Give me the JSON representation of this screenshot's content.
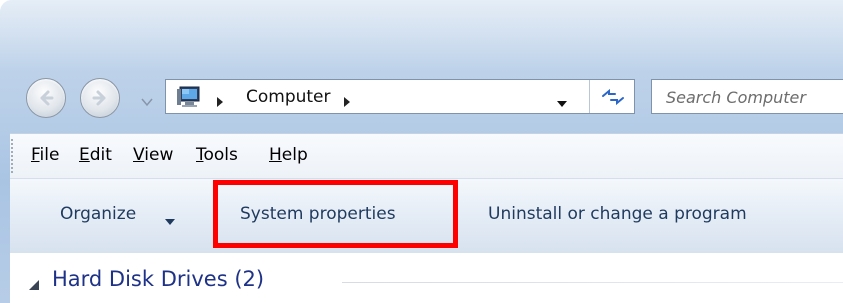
{
  "window": {
    "accent": "#1e3287",
    "frame_color": "#b9cfe8",
    "highlight_color": "#ff0000"
  },
  "navigation": {
    "back_icon": "back-arrow-icon",
    "forward_icon": "forward-arrow-icon",
    "history_icon": "chevron-down-icon"
  },
  "address_bar": {
    "location_icon": "computer-icon",
    "path": "Computer",
    "refresh_icon": "refresh-icon"
  },
  "search": {
    "placeholder": "Search Computer"
  },
  "menu": {
    "items": [
      {
        "label": "File",
        "accel": "F",
        "rest": "ile"
      },
      {
        "label": "Edit",
        "accel": "E",
        "rest": "dit"
      },
      {
        "label": "View",
        "accel": "V",
        "rest": "iew"
      },
      {
        "label": "Tools",
        "accel": "T",
        "rest": "ools"
      },
      {
        "label": "Help",
        "accel": "H",
        "rest": "elp"
      }
    ]
  },
  "commands": {
    "organize": "Organize",
    "system_properties": "System properties",
    "uninstall": "Uninstall or change a program"
  },
  "content": {
    "group_title": "Hard Disk Drives (2)"
  }
}
